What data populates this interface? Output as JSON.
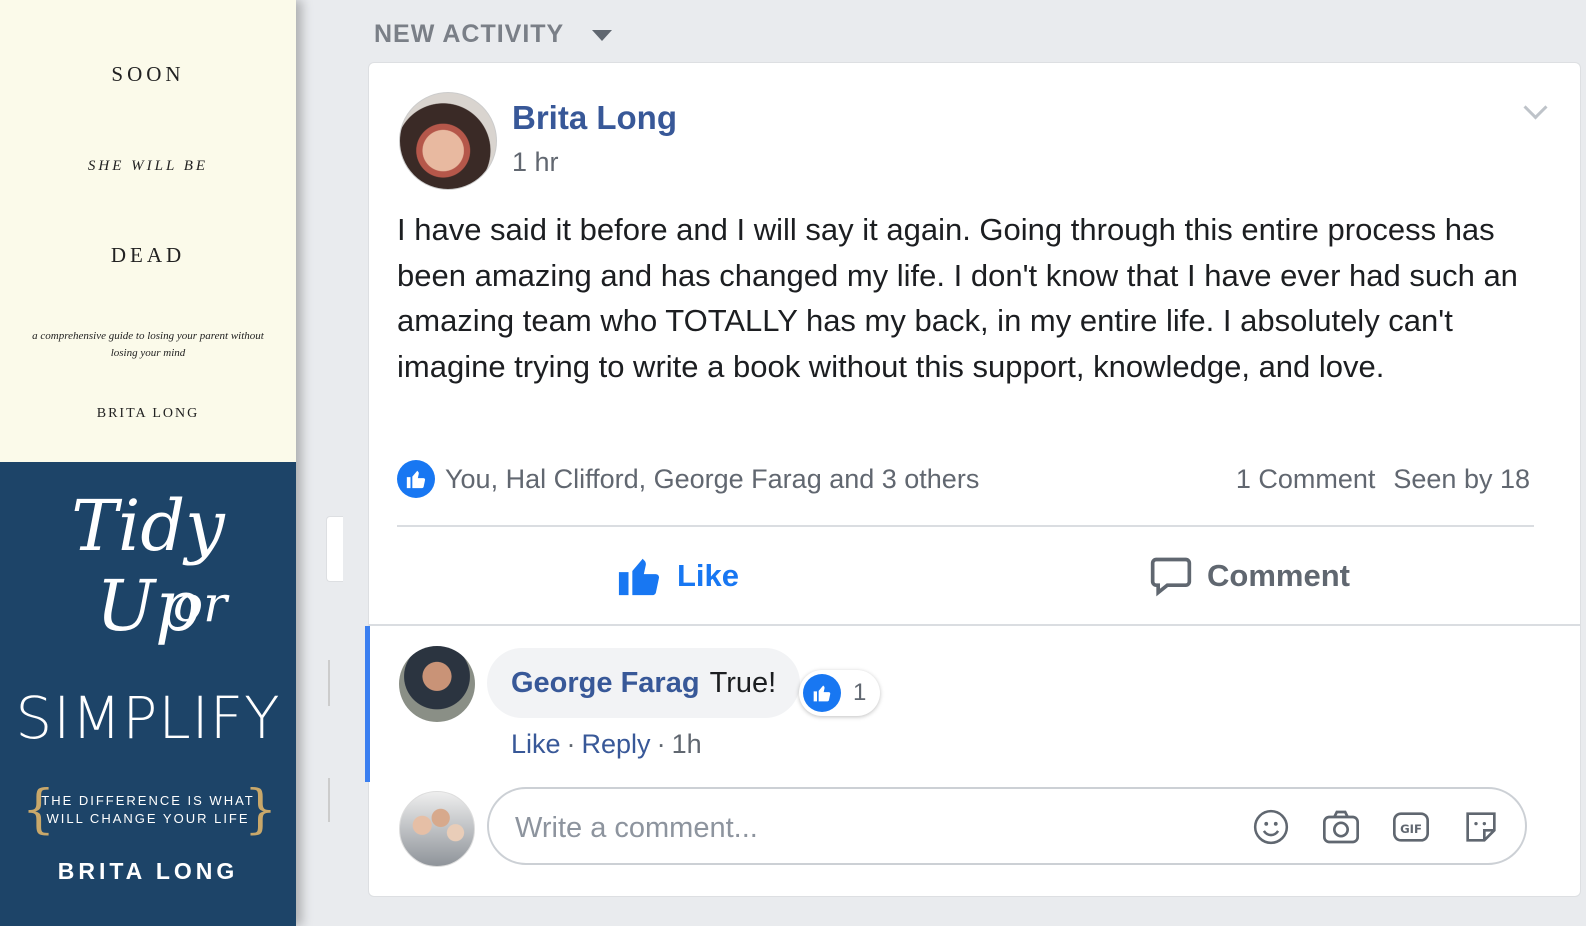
{
  "books": {
    "book1": {
      "line1": "SOON",
      "line2": "SHE WILL BE",
      "line3": "DEAD",
      "subtitle": "a comprehensive guide to losing your parent without losing your mind",
      "author": "BRITA LONG"
    },
    "book2": {
      "script1": "Tidy Up",
      "script2": "or",
      "title": "SIMPLIFY",
      "tagline": "THE DIFFERENCE IS WHAT WILL CHANGE YOUR LIFE",
      "author": "BRITA LONG"
    }
  },
  "feed": {
    "section_label": "NEW ACTIVITY"
  },
  "post": {
    "author": "Brita Long",
    "time": "1 hr",
    "text": "I have said it before and I will say it again. Going through this entire process has been amazing and has changed my life. I don't know that I have ever had such an amazing team who TOTALLY has my back, in my entire life. I absolutely can't imagine trying to write a book without this support, knowledge, and love.",
    "reactors": "You, Hal Clifford, George Farag and 3 others",
    "comment_count": "1 Comment",
    "seen_by": "Seen by 18",
    "like_label": "Like",
    "comment_label": "Comment"
  },
  "comment": {
    "author": "George Farag",
    "text": "True!",
    "reaction_count": "1",
    "like_label": "Like",
    "reply_label": "Reply",
    "age": "1h"
  },
  "composer": {
    "placeholder": "Write a comment...",
    "icons": [
      "emoji-icon",
      "camera-icon",
      "gif-icon",
      "sticker-icon"
    ]
  },
  "colors": {
    "accent": "#1877f2",
    "name_link": "#385898",
    "book2_bg": "#1d4468",
    "book1_bg": "#fbfaea"
  }
}
